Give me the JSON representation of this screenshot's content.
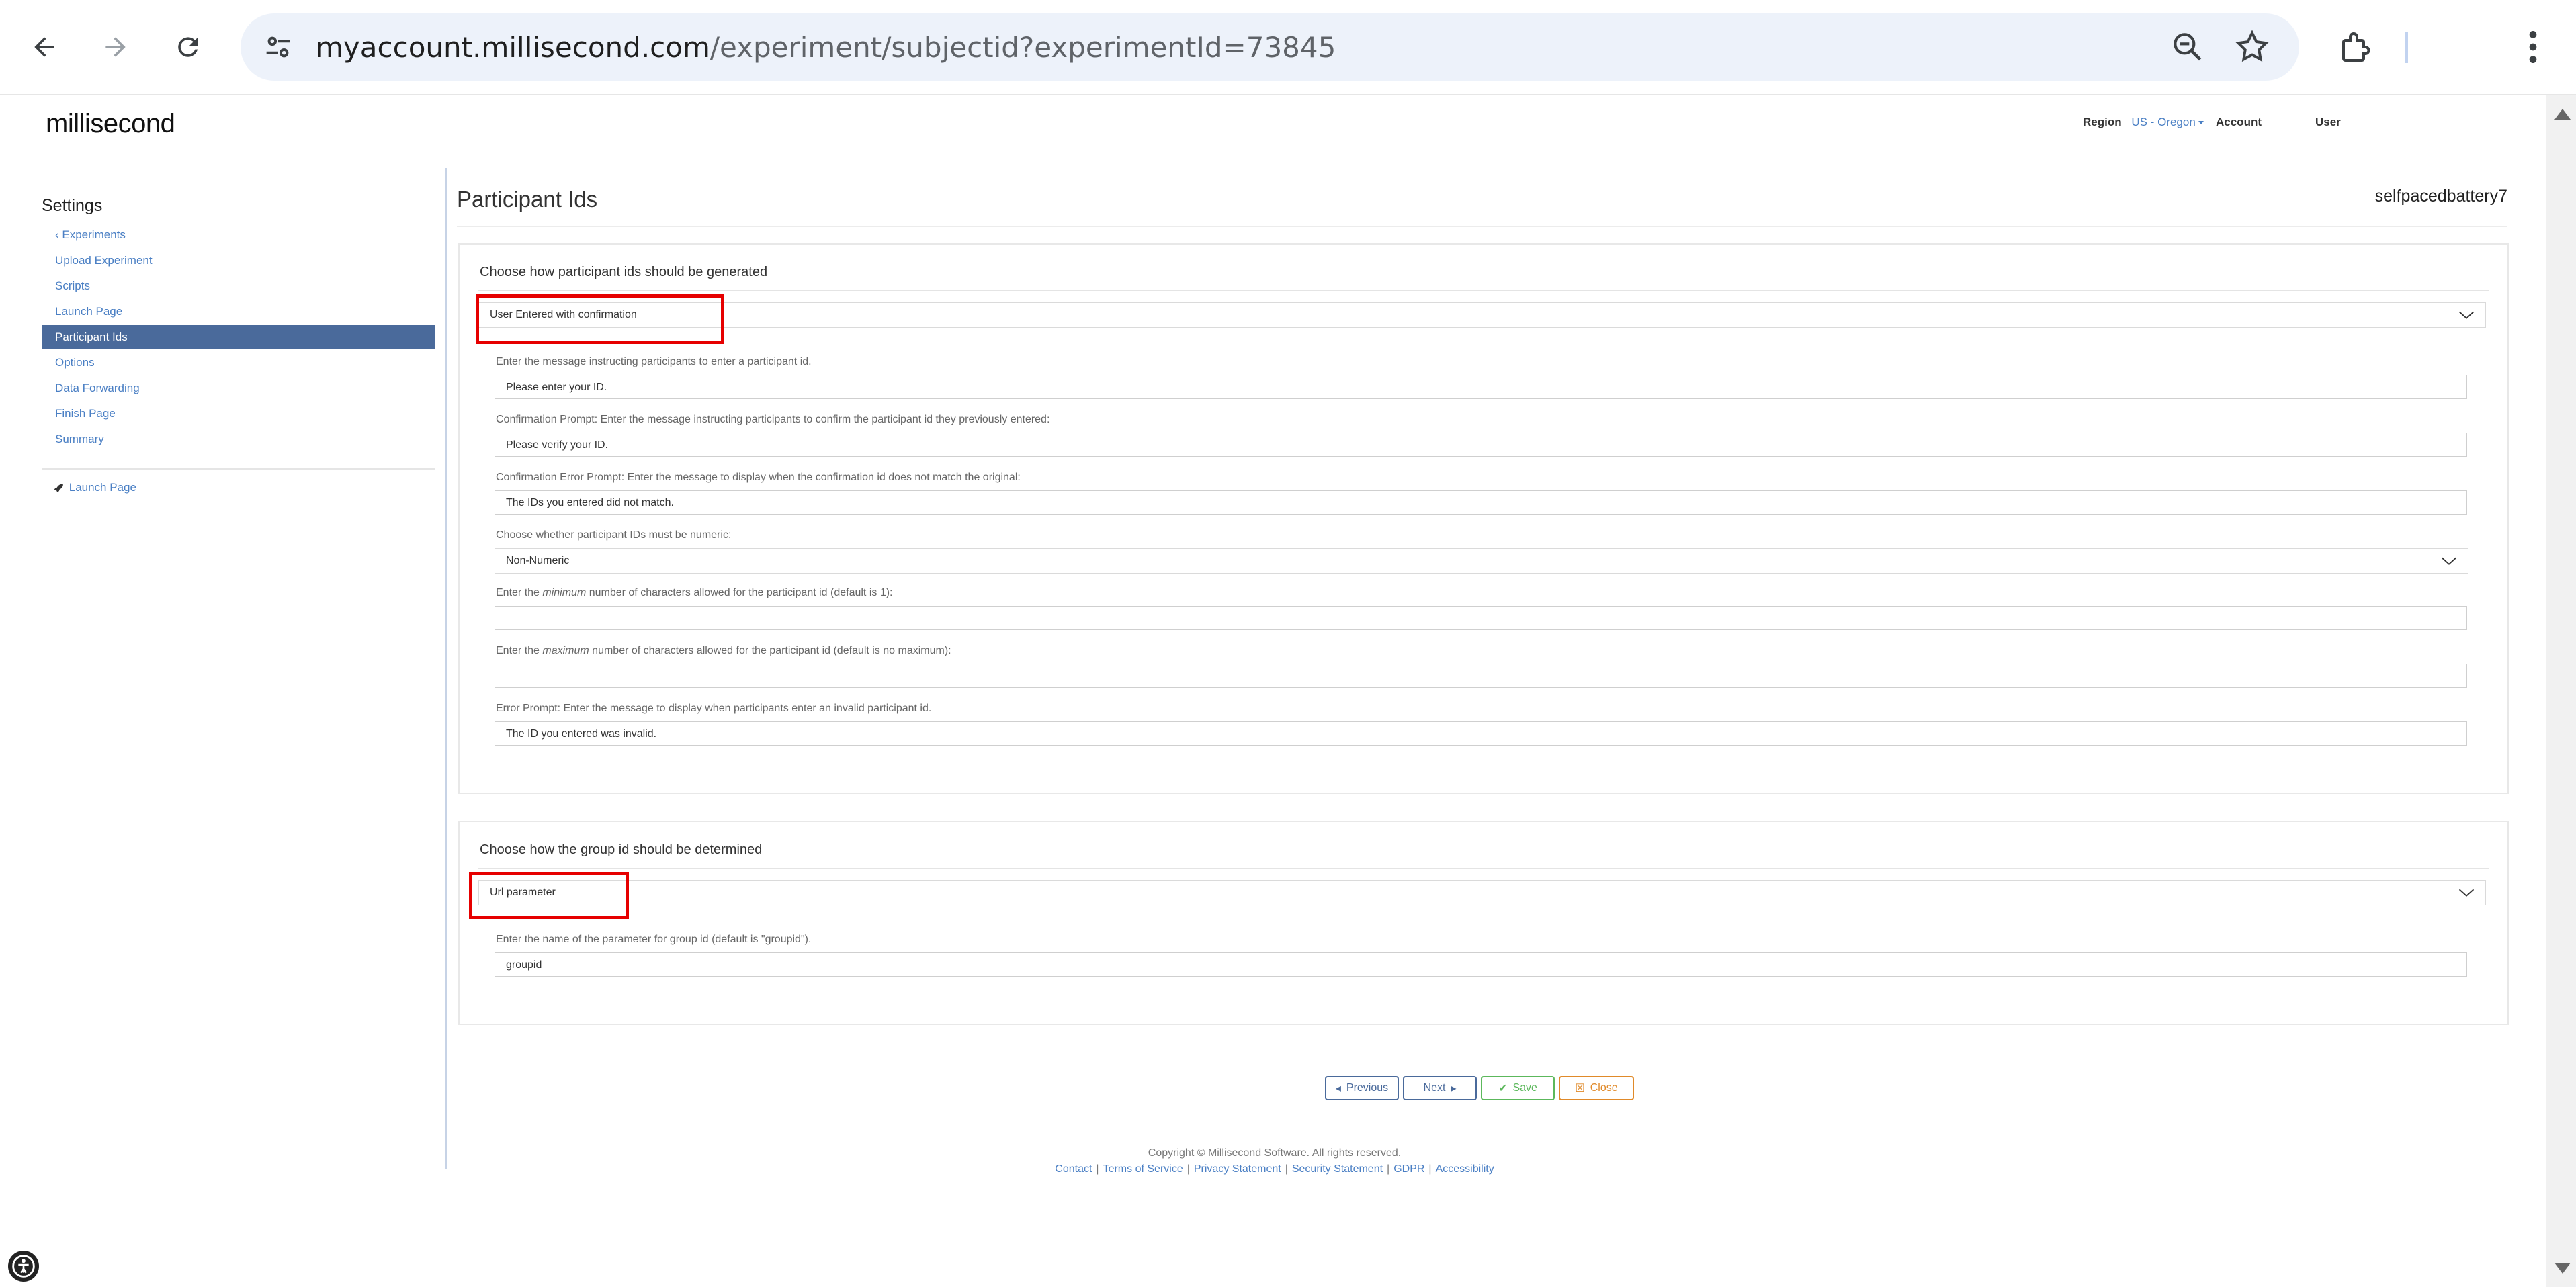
{
  "browser": {
    "url_host": "myaccount.millisecond.com",
    "url_path": "/experiment/subjectid?experimentId=73845"
  },
  "site": {
    "logo": "millisecond",
    "region_label": "Region",
    "region_value": "US - Oregon",
    "account_label": "Account",
    "user_label": "User"
  },
  "sidebar": {
    "heading": "Settings",
    "items": [
      {
        "label": "Experiments"
      },
      {
        "label": "Upload Experiment"
      },
      {
        "label": "Scripts"
      },
      {
        "label": "Launch Page"
      },
      {
        "label": "Participant Ids"
      },
      {
        "label": "Options"
      },
      {
        "label": "Data Forwarding"
      },
      {
        "label": "Finish Page"
      },
      {
        "label": "Summary"
      }
    ],
    "launch_label": "Launch Page"
  },
  "main": {
    "title": "Participant Ids",
    "experiment_name": "selfpacedbattery7",
    "participant_panel": {
      "heading": "Choose how participant ids should be generated",
      "method_value": "User Entered with confirmation",
      "prompt_label": "Enter the message instructing participants to enter a participant id.",
      "prompt_value": "Please enter your ID.",
      "confirm_label": "Confirmation Prompt: Enter the message instructing participants to confirm the participant id they previously entered:",
      "confirm_value": "Please verify your ID.",
      "confirm_error_label": "Confirmation Error Prompt: Enter the message to display when the confirmation id does not match the original:",
      "confirm_error_value": "The IDs you entered did not match.",
      "numeric_label": "Choose whether participant IDs must be numeric:",
      "numeric_value": "Non-Numeric",
      "min_label_pre": "Enter the ",
      "min_label_em": "minimum",
      "min_label_post": " number of characters allowed for the participant id (default is 1):",
      "min_value": "",
      "max_label_pre": "Enter the ",
      "max_label_em": "maximum",
      "max_label_post": " number of characters allowed for the participant id (default is no maximum):",
      "max_value": "",
      "error_label": "Error Prompt: Enter the message to display when participants enter an invalid participant id.",
      "error_value": "The ID you entered was invalid."
    },
    "group_panel": {
      "heading": "Choose how the group id should be determined",
      "method_value": "Url parameter",
      "param_label": "Enter the name of the parameter for group id (default is \"groupid\").",
      "param_value": "groupid"
    },
    "buttons": {
      "previous": "Previous",
      "next": "Next",
      "save": "Save",
      "close": "Close"
    }
  },
  "footer": {
    "copyright": "Copyright © Millisecond Software. All rights reserved.",
    "links": [
      "Contact",
      "Terms of Service",
      "Privacy Statement",
      "Security Statement",
      "GDPR",
      "Accessibility"
    ]
  },
  "colors": {
    "accent": "#4a7fc4",
    "sidebar_active": "#4a6a9b",
    "highlight": "#e60000"
  }
}
